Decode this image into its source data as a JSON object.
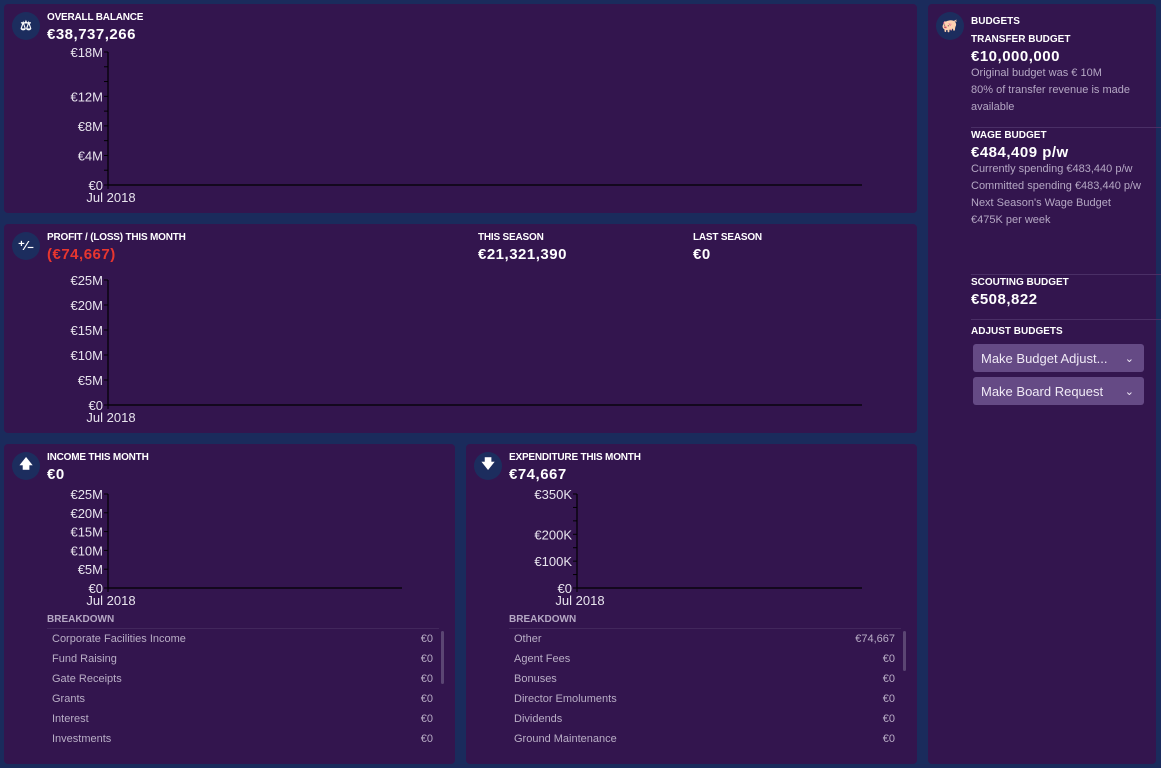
{
  "balance": {
    "label": "OVERALL BALANCE",
    "value": "€38,737,266",
    "icon": "seesaw-icon"
  },
  "profit": {
    "label": "PROFIT / (LOSS) THIS MONTH",
    "value": "(€74,667)",
    "this_season_label": "THIS SEASON",
    "this_season_value": "€21,321,390",
    "last_season_label": "LAST SEASON",
    "last_season_value": "€0",
    "icon": "plus-minus-icon"
  },
  "income": {
    "label": "INCOME THIS MONTH",
    "value": "€0",
    "icon": "arrow-up-icon",
    "breakdown_title": "BREAKDOWN",
    "rows": [
      {
        "name": "Corporate Facilities Income",
        "value": "€0"
      },
      {
        "name": "Fund Raising",
        "value": "€0"
      },
      {
        "name": "Gate Receipts",
        "value": "€0"
      },
      {
        "name": "Grants",
        "value": "€0"
      },
      {
        "name": "Interest",
        "value": "€0"
      },
      {
        "name": "Investments",
        "value": "€0"
      }
    ]
  },
  "expenditure": {
    "label": "EXPENDITURE THIS MONTH",
    "value": "€74,667",
    "icon": "arrow-down-icon",
    "breakdown_title": "BREAKDOWN",
    "rows": [
      {
        "name": "Other",
        "value": "€74,667"
      },
      {
        "name": "Agent Fees",
        "value": "€0"
      },
      {
        "name": "Bonuses",
        "value": "€0"
      },
      {
        "name": "Director Emoluments",
        "value": "€0"
      },
      {
        "name": "Dividends",
        "value": "€0"
      },
      {
        "name": "Ground Maintenance",
        "value": "€0"
      }
    ]
  },
  "budgets": {
    "title": "BUDGETS",
    "icon": "piggy-bank-icon",
    "transfer_label": "TRANSFER BUDGET",
    "transfer_value": "€10,000,000",
    "transfer_note1": "Original budget was € 10M",
    "transfer_note2": "80% of transfer revenue is made available",
    "wage_label": "WAGE BUDGET",
    "wage_value": "€484,409 p/w",
    "wage_note1": "Currently spending €483,440 p/w",
    "wage_note2": "Committed spending €483,440 p/w",
    "wage_note3": "Next Season's Wage Budget €475K per week",
    "scouting_label": "SCOUTING BUDGET",
    "scouting_value": "€508,822",
    "adjust_label": "ADJUST BUDGETS",
    "adjust_button": "Make Budget Adjust...",
    "board_button": "Make Board Request"
  },
  "chart_data": [
    {
      "type": "line",
      "title": "OVERALL BALANCE",
      "ylim": [
        0,
        18000000
      ],
      "yticks": [
        {
          "v": 0,
          "l": "€0"
        },
        {
          "v": 4000000,
          "l": "€4M"
        },
        {
          "v": 8000000,
          "l": "€8M"
        },
        {
          "v": 12000000,
          "l": "€12M"
        },
        {
          "v": 18000000,
          "l": "€18M"
        }
      ],
      "minor_step": 2000000,
      "x_ticks": [
        "Jul 2018"
      ],
      "series": []
    },
    {
      "type": "line",
      "title": "PROFIT / (LOSS) THIS MONTH",
      "ylim": [
        0,
        25000000
      ],
      "yticks": [
        {
          "v": 0,
          "l": "€0"
        },
        {
          "v": 5000000,
          "l": "€5M"
        },
        {
          "v": 10000000,
          "l": "€10M"
        },
        {
          "v": 15000000,
          "l": "€15M"
        },
        {
          "v": 20000000,
          "l": "€20M"
        },
        {
          "v": 25000000,
          "l": "€25M"
        }
      ],
      "minor_step": 5000000,
      "x_ticks": [
        "Jul 2018"
      ],
      "series": []
    },
    {
      "type": "line",
      "title": "INCOME THIS MONTH",
      "ylim": [
        0,
        25000000
      ],
      "yticks": [
        {
          "v": 0,
          "l": "€0"
        },
        {
          "v": 5000000,
          "l": "€5M"
        },
        {
          "v": 10000000,
          "l": "€10M"
        },
        {
          "v": 15000000,
          "l": "€15M"
        },
        {
          "v": 20000000,
          "l": "€20M"
        },
        {
          "v": 25000000,
          "l": "€25M"
        }
      ],
      "minor_step": 5000000,
      "x_ticks": [
        "Jul 2018"
      ],
      "series": []
    },
    {
      "type": "line",
      "title": "EXPENDITURE THIS MONTH",
      "ylim": [
        0,
        350000
      ],
      "yticks": [
        {
          "v": 0,
          "l": "€0"
        },
        {
          "v": 100000,
          "l": "€100K"
        },
        {
          "v": 200000,
          "l": "€200K"
        },
        {
          "v": 350000,
          "l": "€350K"
        }
      ],
      "minor_step": 50000,
      "x_ticks": [
        "Jul 2018"
      ],
      "series": []
    }
  ]
}
